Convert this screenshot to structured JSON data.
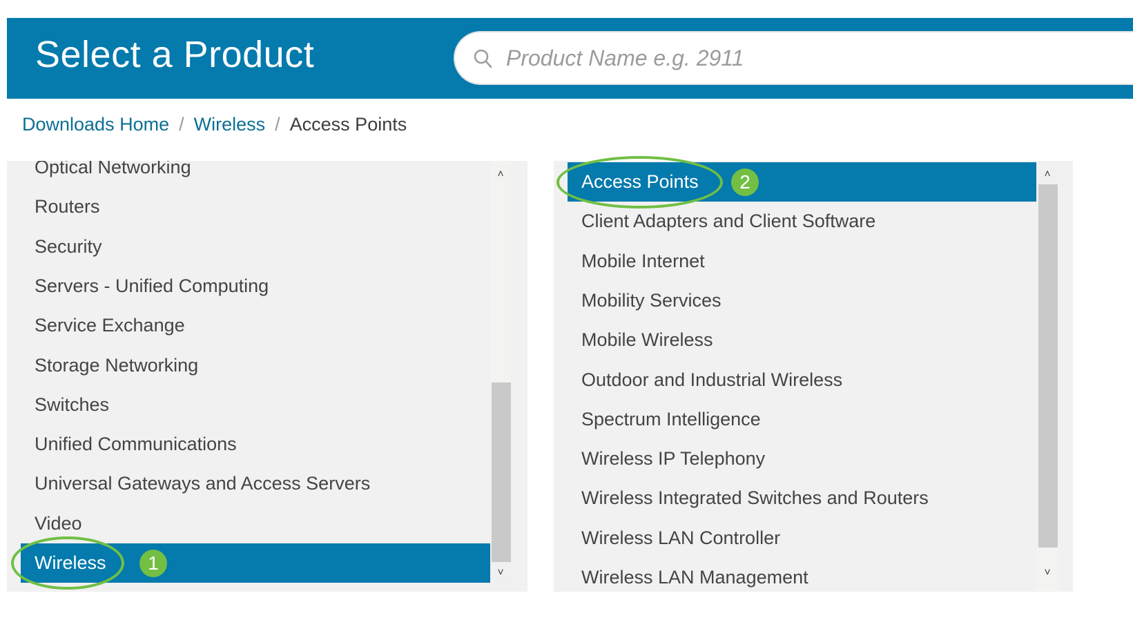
{
  "header": {
    "title": "Select a Product",
    "search": {
      "placeholder": "Product Name e.g. 2911",
      "value": "",
      "icon": "search-icon"
    }
  },
  "breadcrumb": {
    "items": [
      {
        "label": "Downloads Home",
        "link": true
      },
      {
        "label": "Wireless",
        "link": true
      },
      {
        "label": "Access Points",
        "link": false
      }
    ],
    "separator": "/"
  },
  "left_panel": {
    "items": [
      {
        "label": "Optical Networking",
        "selected": false
      },
      {
        "label": "Routers",
        "selected": false
      },
      {
        "label": "Security",
        "selected": false
      },
      {
        "label": "Servers - Unified Computing",
        "selected": false
      },
      {
        "label": "Service Exchange",
        "selected": false
      },
      {
        "label": "Storage Networking",
        "selected": false
      },
      {
        "label": "Switches",
        "selected": false
      },
      {
        "label": "Unified Communications",
        "selected": false
      },
      {
        "label": "Universal Gateways and Access Servers",
        "selected": false
      },
      {
        "label": "Video",
        "selected": false
      },
      {
        "label": "Wireless",
        "selected": true
      }
    ],
    "annotation_step": "1"
  },
  "right_panel": {
    "items": [
      {
        "label": "Access Points",
        "selected": true
      },
      {
        "label": "Client Adapters and Client Software",
        "selected": false
      },
      {
        "label": "Mobile Internet",
        "selected": false
      },
      {
        "label": "Mobility Services",
        "selected": false
      },
      {
        "label": "Mobile Wireless",
        "selected": false
      },
      {
        "label": "Outdoor and Industrial Wireless",
        "selected": false
      },
      {
        "label": "Spectrum Intelligence",
        "selected": false
      },
      {
        "label": "Wireless IP Telephony",
        "selected": false
      },
      {
        "label": "Wireless Integrated Switches and Routers",
        "selected": false
      },
      {
        "label": "Wireless LAN Controller",
        "selected": false
      },
      {
        "label": "Wireless LAN Management",
        "selected": false
      }
    ],
    "annotation_step": "2"
  },
  "scroll_glyphs": {
    "up": "˄",
    "down": "˅"
  },
  "colors": {
    "brand_blue": "#047aad",
    "link_blue": "#0b6f94",
    "annotation_green": "#72bf44",
    "panel_bg": "#f1f1f1"
  }
}
